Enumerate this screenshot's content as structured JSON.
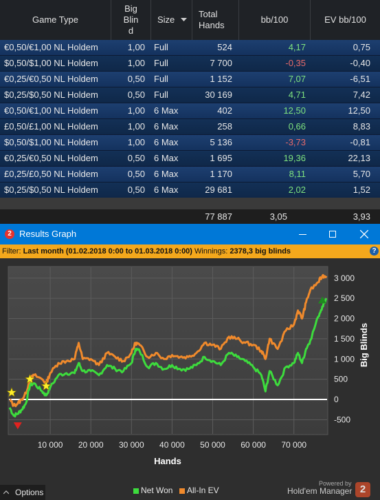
{
  "table": {
    "columns": [
      "Game Type",
      "Big Blind",
      "Size",
      "Total Hands",
      "bb/100",
      "EV bb/100"
    ],
    "big_blind_header_lines": [
      "Big",
      "Blin",
      "d"
    ],
    "total_hands_header_lines": [
      "Total",
      "Hands"
    ],
    "rows": [
      {
        "game": "€0,50/€1,00 NL Holdem",
        "bb": "1,00",
        "size": "Full",
        "hands": "524",
        "bb100": "4,17",
        "ev": "0,75",
        "sign": "pos"
      },
      {
        "game": "$0,50/$1,00 NL Holdem",
        "bb": "1,00",
        "size": "Full",
        "hands": "7 700",
        "bb100": "-0,35",
        "ev": "-0,40",
        "sign": "neg"
      },
      {
        "game": "€0,25/€0,50 NL Holdem",
        "bb": "0,50",
        "size": "Full",
        "hands": "1 152",
        "bb100": "7,07",
        "ev": "-6,51",
        "sign": "pos"
      },
      {
        "game": "$0,25/$0,50 NL Holdem",
        "bb": "0,50",
        "size": "Full",
        "hands": "30 169",
        "bb100": "4,71",
        "ev": "7,42",
        "sign": "pos"
      },
      {
        "game": "€0,50/€1,00 NL Holdem",
        "bb": "1,00",
        "size": "6 Max",
        "hands": "402",
        "bb100": "12,50",
        "ev": "12,50",
        "sign": "pos"
      },
      {
        "game": "£0,50/£1,00 NL Holdem",
        "bb": "1,00",
        "size": "6 Max",
        "hands": "258",
        "bb100": "0,66",
        "ev": "8,83",
        "sign": "pos"
      },
      {
        "game": "$0,50/$1,00 NL Holdem",
        "bb": "1,00",
        "size": "6 Max",
        "hands": "5 136",
        "bb100": "-3,73",
        "ev": "-0,81",
        "sign": "neg"
      },
      {
        "game": "€0,25/€0,50 NL Holdem",
        "bb": "0,50",
        "size": "6 Max",
        "hands": "1 695",
        "bb100": "19,36",
        "ev": "22,13",
        "sign": "pos"
      },
      {
        "game": "£0,25/£0,50 NL Holdem",
        "bb": "0,50",
        "size": "6 Max",
        "hands": "1 170",
        "bb100": "8,11",
        "ev": "5,70",
        "sign": "pos"
      },
      {
        "game": "$0,25/$0,50 NL Holdem",
        "bb": "0,50",
        "size": "6 Max",
        "hands": "29 681",
        "bb100": "2,02",
        "ev": "1,52",
        "sign": "pos"
      }
    ],
    "totals": {
      "hands": "77 887",
      "bb100": "3,05",
      "ev": "3,93"
    }
  },
  "window": {
    "title": "Results Graph",
    "app_badge": "2"
  },
  "filter": {
    "label": "Filter:",
    "range": "Last month (01.02.2018 0:00 to 01.03.2018 0:00)",
    "winnings_label": "Winnings:",
    "winnings_value": "2378,3 big blinds",
    "help": "?"
  },
  "footer": {
    "options": "Options",
    "powered_by": "Powered by",
    "brand": "Hold'em Manager",
    "brand_badge": "2"
  },
  "colors": {
    "net_won": "#3ddc3d",
    "all_in_ev": "#f08a2c",
    "zero_line": "#ffffff",
    "title_bar": "#0078d7",
    "filter_bar": "#f4a81c"
  },
  "chart_data": {
    "type": "line",
    "xlabel": "Hands",
    "ylabel": "Big Blinds",
    "xlim": [
      0,
      78000
    ],
    "ylim": [
      -800,
      3200
    ],
    "x_ticks": [
      10000,
      20000,
      30000,
      40000,
      50000,
      60000,
      70000
    ],
    "x_tick_labels": [
      "10 000",
      "20 000",
      "30 000",
      "40 000",
      "50 000",
      "60 000",
      "70 000"
    ],
    "y_ticks": [
      -500,
      0,
      500,
      1000,
      1500,
      2000,
      2500,
      3000
    ],
    "y_tick_labels": [
      "-500",
      "0",
      "500",
      "1 000",
      "1 500",
      "2 000",
      "2 500",
      "3 000"
    ],
    "grid": true,
    "legend_position": "bottom",
    "series": [
      {
        "name": "Net Won",
        "x": [
          0,
          1000,
          2000,
          3000,
          4000,
          5000,
          6000,
          8000,
          9000,
          10000,
          12000,
          14000,
          16000,
          17000,
          18000,
          20000,
          22000,
          24000,
          26000,
          28000,
          30000,
          31000,
          32000,
          34000,
          36000,
          38000,
          40000,
          42000,
          44000,
          46000,
          48000,
          50000,
          52000,
          54000,
          56000,
          58000,
          60000,
          62000,
          63000,
          64000,
          66000,
          68000,
          70000,
          71000,
          72000,
          73000,
          74000,
          76000,
          77000,
          78000
        ],
        "y": [
          -200,
          -400,
          -350,
          -250,
          -100,
          350,
          400,
          200,
          100,
          300,
          600,
          650,
          650,
          900,
          700,
          700,
          600,
          850,
          750,
          700,
          900,
          1250,
          1200,
          800,
          900,
          750,
          850,
          750,
          750,
          850,
          1050,
          950,
          850,
          1150,
          1050,
          950,
          800,
          600,
          200,
          700,
          350,
          800,
          900,
          1150,
          900,
          1250,
          1450,
          2050,
          2300,
          2500
        ]
      },
      {
        "name": "All-In EV",
        "x": [
          0,
          1000,
          2000,
          3000,
          4000,
          5000,
          6000,
          8000,
          9000,
          10000,
          12000,
          14000,
          16000,
          17000,
          18000,
          20000,
          22000,
          24000,
          26000,
          28000,
          30000,
          31000,
          32000,
          34000,
          36000,
          38000,
          40000,
          42000,
          44000,
          46000,
          48000,
          50000,
          52000,
          54000,
          56000,
          58000,
          60000,
          62000,
          63000,
          64000,
          66000,
          68000,
          70000,
          71000,
          72000,
          73000,
          74000,
          76000,
          77000,
          78000
        ],
        "y": [
          0,
          -150,
          -100,
          0,
          150,
          500,
          600,
          500,
          400,
          650,
          900,
          950,
          1000,
          1400,
          1000,
          1000,
          850,
          1150,
          1050,
          950,
          1150,
          1400,
          1350,
          1050,
          1150,
          1000,
          1100,
          1050,
          1050,
          1150,
          1400,
          1350,
          1250,
          1550,
          1500,
          1400,
          1350,
          1200,
          1000,
          1500,
          1250,
          1700,
          1850,
          2200,
          2000,
          2400,
          2700,
          2900,
          3050,
          3050
        ]
      }
    ],
    "markers": [
      {
        "type": "star",
        "x": 500,
        "y": 170
      },
      {
        "type": "star",
        "x": 5000,
        "y": 500
      },
      {
        "type": "star",
        "x": 9000,
        "y": 330
      },
      {
        "type": "triangle-down",
        "x": 2000,
        "y": -650
      },
      {
        "type": "triangle-up",
        "x": 77000,
        "y": 2460
      }
    ]
  }
}
